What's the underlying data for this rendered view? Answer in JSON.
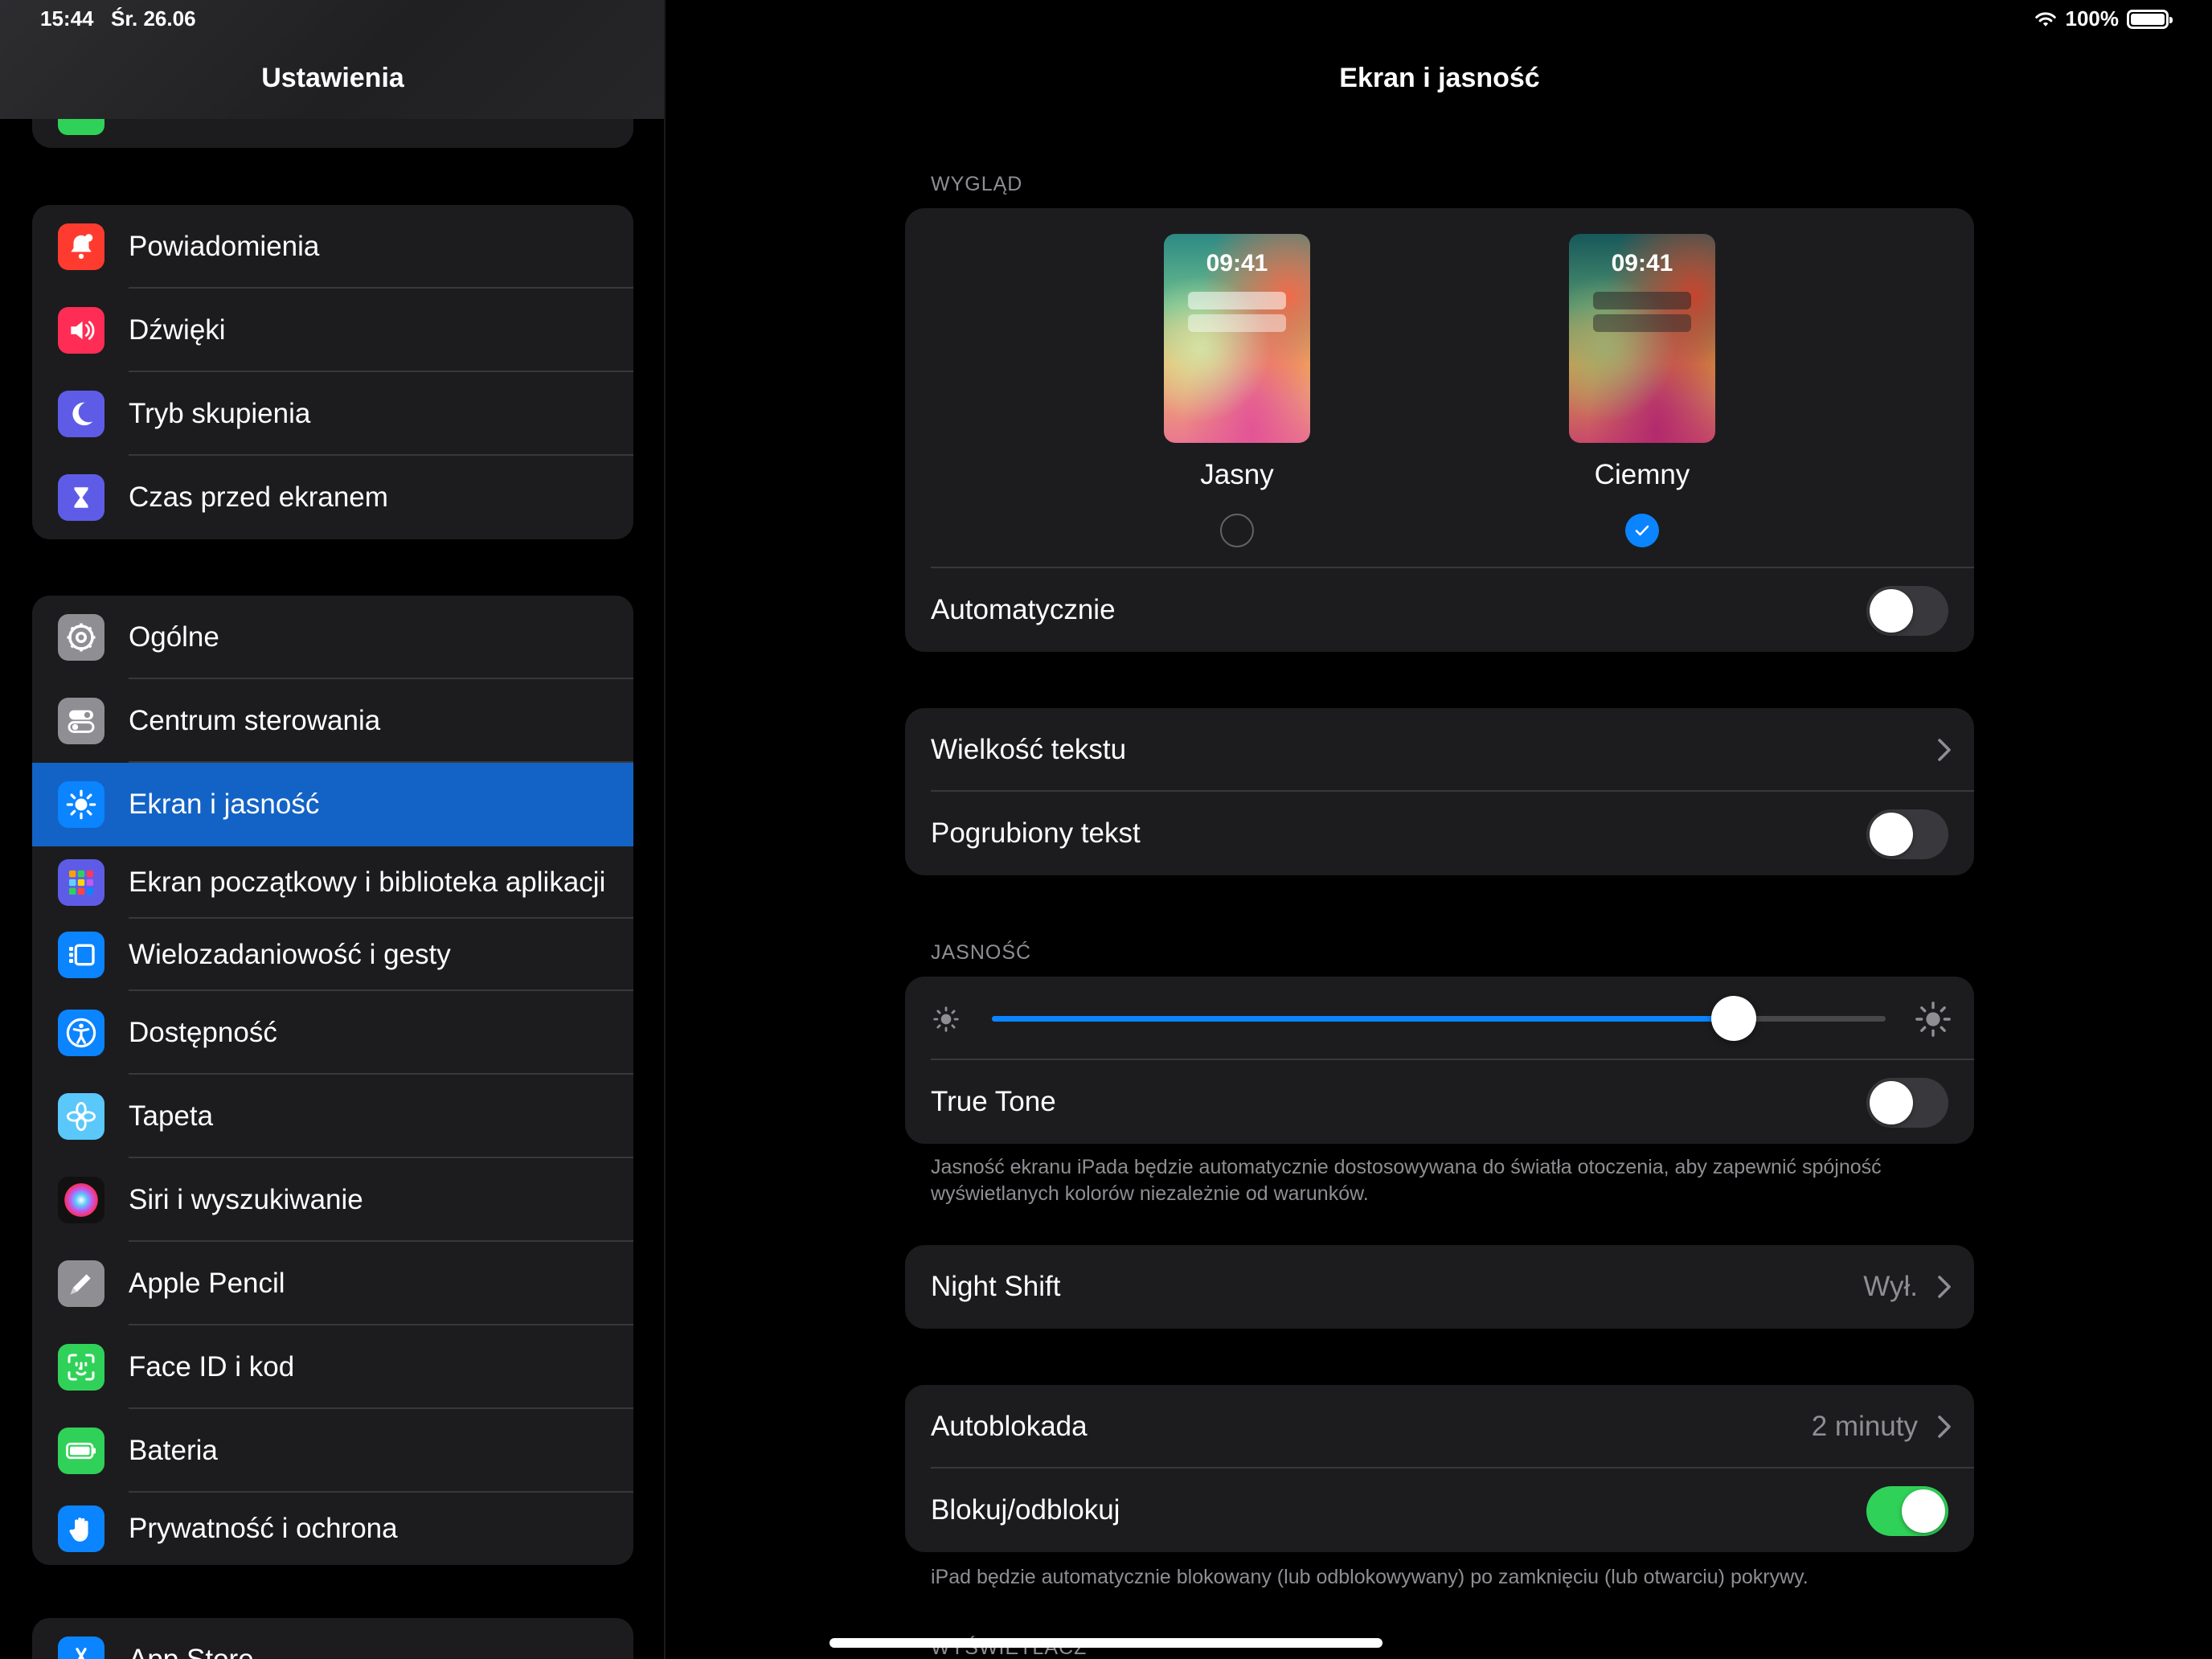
{
  "status": {
    "time": "15:44",
    "date": "Śr. 26.06",
    "battery": "100%"
  },
  "sidebar": {
    "title": "Ustawienia",
    "group1": [
      {
        "label": "Powiadomienia",
        "icon": "bell-icon",
        "color": "#ff3b30"
      },
      {
        "label": "Dźwięki",
        "icon": "speaker-icon",
        "color": "#ff2d55"
      },
      {
        "label": "Tryb skupienia",
        "icon": "moon-icon",
        "color": "#5e5ce6"
      },
      {
        "label": "Czas przed ekranem",
        "icon": "hourglass-icon",
        "color": "#5e5ce6"
      }
    ],
    "group2": [
      {
        "label": "Ogólne",
        "icon": "gear-icon",
        "color": "#8e8e93"
      },
      {
        "label": "Centrum sterowania",
        "icon": "toggles-icon",
        "color": "#8e8e93"
      },
      {
        "label": "Ekran i jasność",
        "icon": "sun-icon",
        "color": "#0a84ff",
        "selected": true
      },
      {
        "label": "Ekran początkowy i biblioteka aplikacji",
        "icon": "app-grid-icon",
        "color": "#5e5ce6"
      },
      {
        "label": "Wielozadaniowość i gesty",
        "icon": "multitasking-icon",
        "color": "#0a84ff"
      },
      {
        "label": "Dostępność",
        "icon": "accessibility-icon",
        "color": "#0a84ff"
      },
      {
        "label": "Tapeta",
        "icon": "flower-icon",
        "color": "#5ac8fa"
      },
      {
        "label": "Siri i wyszukiwanie",
        "icon": "siri-icon",
        "color": "#1c1c1e"
      },
      {
        "label": "Apple Pencil",
        "icon": "pencil-icon",
        "color": "#8e8e93"
      },
      {
        "label": "Face ID i kod",
        "icon": "faceid-icon",
        "color": "#30d158"
      },
      {
        "label": "Bateria",
        "icon": "battery-icon",
        "color": "#30d158"
      },
      {
        "label": "Prywatność i ochrona",
        "icon": "hand-icon",
        "color": "#0a84ff"
      }
    ],
    "group3": [
      {
        "label": "App Store",
        "icon": "appstore-icon",
        "color": "#0a84ff"
      }
    ]
  },
  "main": {
    "title": "Ekran i jasność",
    "appearance": {
      "section": "WYGLĄD",
      "preview_time": "09:41",
      "light_label": "Jasny",
      "dark_label": "Ciemny",
      "selected": "dark",
      "automatic_label": "Automatycznie",
      "automatic_on": false
    },
    "text": {
      "size_label": "Wielkość tekstu",
      "bold_label": "Pogrubiony tekst",
      "bold_on": false
    },
    "brightness": {
      "section": "JASNOŚĆ",
      "level": 0.83,
      "true_tone_label": "True Tone",
      "true_tone_on": false,
      "footnote": "Jasność ekranu iPada będzie automatycznie dostosowywana do światła otoczenia, aby zapewnić spójność wyświetlanych kolorów niezależnie od warunków."
    },
    "night_shift": {
      "label": "Night Shift",
      "value": "Wył."
    },
    "lock": {
      "autolock_label": "Autoblokada",
      "autolock_value": "2 minuty",
      "lock_unlock_label": "Blokuj/odblokuj",
      "lock_unlock_on": true,
      "footnote": "iPad będzie automatycznie blokowany (lub odblokowywany) po zamknięciu (lub otwarciu) pokrywy."
    },
    "display_section": "WYŚWIETLACZ"
  },
  "colors": {
    "accent": "#0a84ff",
    "selected_row": "#1363c6",
    "toggle_on": "#30d158"
  }
}
